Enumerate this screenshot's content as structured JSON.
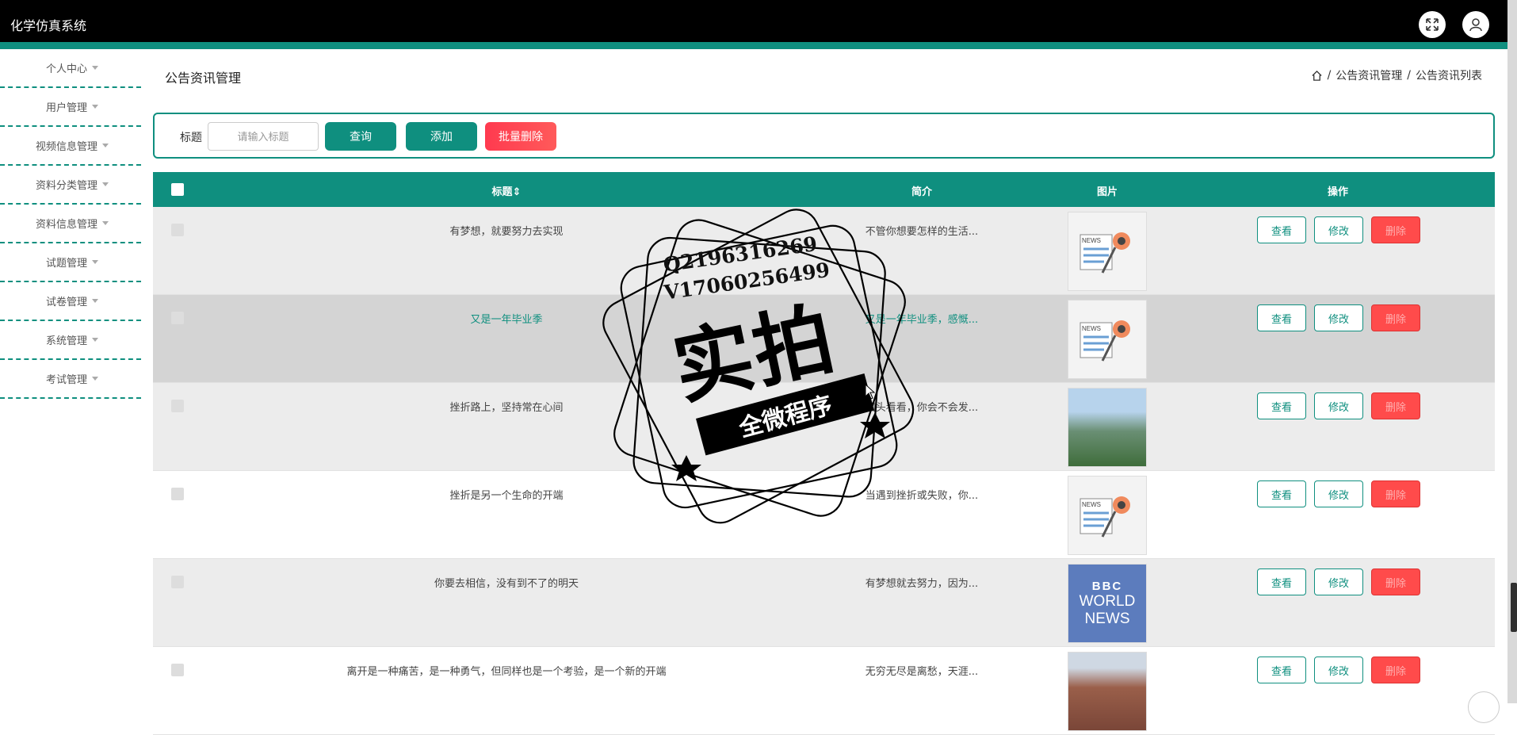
{
  "app": {
    "title": "化学仿真系统"
  },
  "topbar": {
    "fullscreen_icon": "expand-icon",
    "user_icon": "user-icon",
    "brand_color": "#0f8f7f"
  },
  "sidebar": {
    "items": [
      {
        "label": "个人中心"
      },
      {
        "label": "用户管理"
      },
      {
        "label": "视频信息管理"
      },
      {
        "label": "资料分类管理"
      },
      {
        "label": "资料信息管理"
      },
      {
        "label": "试题管理"
      },
      {
        "label": "试卷管理"
      },
      {
        "label": "系统管理"
      },
      {
        "label": "考试管理"
      }
    ]
  },
  "main": {
    "page_title": "公告资讯管理",
    "breadcrumb": {
      "home_icon": "home-icon",
      "sep": "/",
      "level1": "公告资讯管理",
      "level2": "公告资讯列表"
    }
  },
  "search": {
    "label": "标题",
    "placeholder": "请输入标题",
    "value": "",
    "query_label": "查询",
    "add_label": "添加",
    "batch_delete_label": "批量删除"
  },
  "table": {
    "headers": {
      "title": "标题",
      "title_sort_icon": "sort-icon",
      "intro": "简介",
      "image": "图片",
      "actions": "操作"
    },
    "action_labels": {
      "view": "查看",
      "edit": "修改",
      "delete": "删除"
    },
    "rows": [
      {
        "title": "有梦想，就要努力去实现",
        "intro": "不管你想要怎样的生活...",
        "image": "news-icon"
      },
      {
        "title": "又是一年毕业季",
        "intro": "又是一年毕业季，感慨...",
        "image": "news-icon"
      },
      {
        "title": "挫折路上，坚持常在心间",
        "intro": "回头看看，你会不会发...",
        "image": "building-photo"
      },
      {
        "title": "挫折是另一个生命的开端",
        "intro": "当遇到挫折或失败，你...",
        "image": "news-icon"
      },
      {
        "title": "你要去相信，没有到不了的明天",
        "intro": "有梦想就去努力，因为...",
        "image": "bbc-world-news"
      },
      {
        "title": "离开是一种痛苦，是一种勇气，但同样也是一个考验，是一个新的开端",
        "intro": "无穷无尽是离愁，天涯...",
        "image": "campus-photo"
      }
    ],
    "bbc_text": {
      "logo": "BBC",
      "line1": "WORLD",
      "line2": "NEWS"
    }
  },
  "watermark": {
    "line1": "Q2196316269",
    "line2": "V17060256499",
    "big": "实拍",
    "banner": "全微程序"
  }
}
